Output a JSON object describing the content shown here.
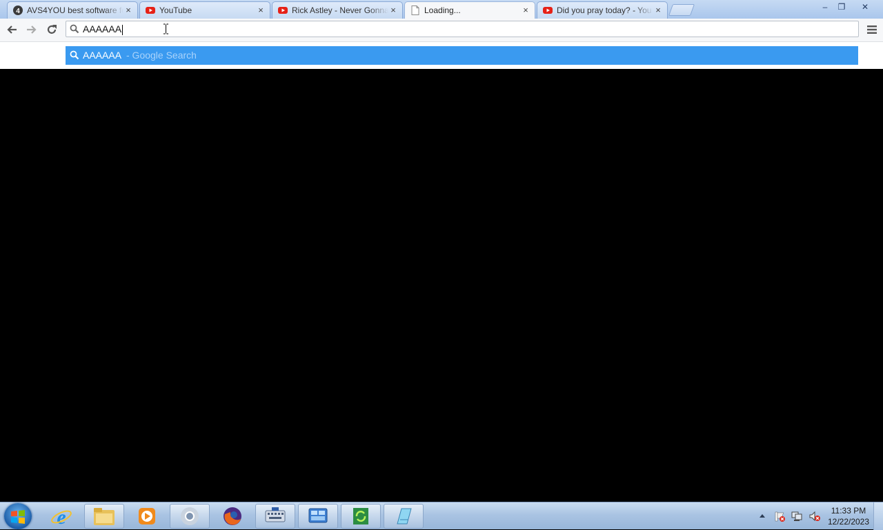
{
  "tabs": [
    {
      "title": "AVS4YOU best software fo",
      "favicon": "avs4you-icon",
      "active": false
    },
    {
      "title": "YouTube",
      "favicon": "youtube-icon",
      "active": false
    },
    {
      "title": "Rick Astley - Never Gonna",
      "favicon": "youtube-icon",
      "active": false
    },
    {
      "title": "Loading...",
      "favicon": "page-icon",
      "active": true
    },
    {
      "title": "Did you pray today? - You",
      "favicon": "youtube-icon",
      "active": false
    }
  ],
  "tab_close_glyph": "×",
  "window_controls": {
    "minimize": "–",
    "restore": "❐",
    "close": "✕"
  },
  "omnibox": {
    "value": "AAAAAA"
  },
  "suggestion": {
    "query": "AAAAAA",
    "description": " - Google Search"
  },
  "colors": {
    "suggestion_highlight": "#3a9af0",
    "youtube_red": "#e62117"
  },
  "taskbar": {
    "pinned": [
      {
        "name": "internet-explorer-icon",
        "open": false
      },
      {
        "name": "file-explorer-icon",
        "open": true
      },
      {
        "name": "media-player-icon",
        "open": false
      },
      {
        "name": "chrome-icon",
        "open": true
      },
      {
        "name": "firefox-icon",
        "open": false
      },
      {
        "name": "on-screen-keyboard-icon",
        "open": true
      },
      {
        "name": "control-panel-icon",
        "open": true
      },
      {
        "name": "sync-app-icon",
        "open": true
      },
      {
        "name": "notepad-icon",
        "open": true
      }
    ],
    "tray_icons": [
      "show-hidden-icons-icon",
      "action-center-icon",
      "network-icon",
      "volume-muted-icon"
    ]
  },
  "clock": {
    "time": "11:33 PM",
    "date": "12/22/2023"
  }
}
